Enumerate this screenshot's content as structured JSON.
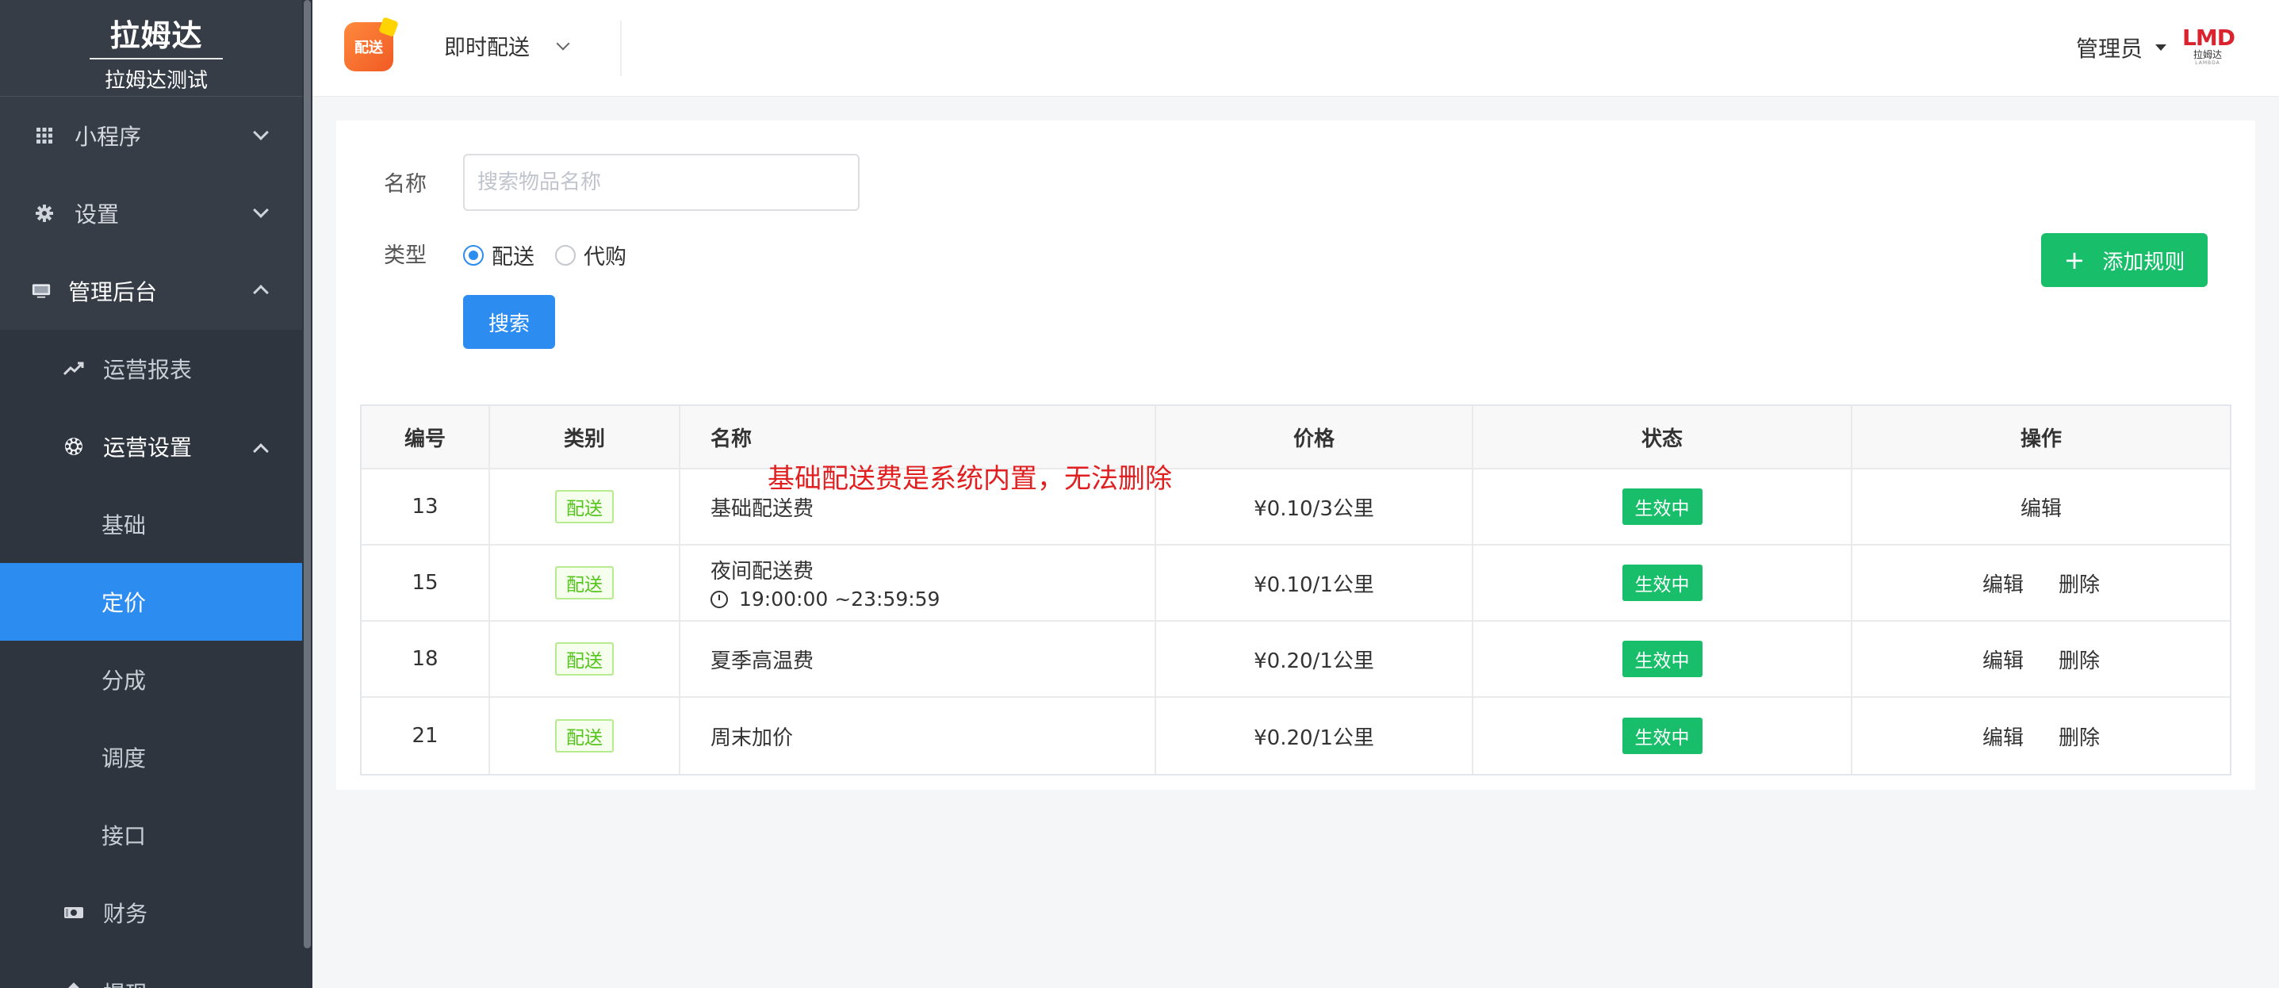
{
  "brand": {
    "title": "拉姆达",
    "subtitle": "拉姆达测试"
  },
  "sidebar": {
    "menus": [
      {
        "label": "小程序",
        "icon": "grid-icon"
      },
      {
        "label": "设置",
        "icon": "gear-icon"
      },
      {
        "label": "管理后台",
        "icon": "monitor-icon"
      }
    ],
    "sub": [
      {
        "label": "运营报表",
        "icon": "trend-icon"
      },
      {
        "label": "运营设置",
        "icon": "cog-icon"
      }
    ],
    "leaves": [
      "基础",
      "定价",
      "分成",
      "调度",
      "接口"
    ],
    "finance": {
      "label": "财务",
      "icon": "money-icon"
    },
    "cutoff": "提现"
  },
  "header": {
    "mode": "即时配送",
    "admin": "管理员",
    "lmd_main": "LMD",
    "lmd_sub": "拉姆达",
    "lmd_tiny": "LAMBDA",
    "logo_text": "配送",
    "accent": "#2d8cf0",
    "success": "#19be6b"
  },
  "form": {
    "name_label": "名称",
    "name_placeholder": "搜索物品名称",
    "type_label": "类型",
    "radio_options": [
      "配送",
      "代购"
    ],
    "radio_selected": "配送",
    "search_button": "搜索",
    "add_button": "添加规则"
  },
  "table": {
    "columns": [
      "编号",
      "类别",
      "名称",
      "价格",
      "状态",
      "操作"
    ],
    "rows": [
      {
        "id": "13",
        "type": "配送",
        "name": "基础配送费",
        "time": "",
        "price": "¥0.10/3公里",
        "status": "生效中",
        "edit": "编辑",
        "delete": ""
      },
      {
        "id": "15",
        "type": "配送",
        "name": "夜间配送费",
        "time": "19:00:00 ~23:59:59",
        "price": "¥0.10/1公里",
        "status": "生效中",
        "edit": "编辑",
        "delete": "删除"
      },
      {
        "id": "18",
        "type": "配送",
        "name": "夏季高温费",
        "time": "",
        "price": "¥0.20/1公里",
        "status": "生效中",
        "edit": "编辑",
        "delete": "删除"
      },
      {
        "id": "21",
        "type": "配送",
        "name": "周末加价",
        "time": "",
        "price": "¥0.20/1公里",
        "status": "生效中",
        "edit": "编辑",
        "delete": "删除"
      }
    ]
  },
  "annotation": "基础配送费是系统内置，无法删除"
}
